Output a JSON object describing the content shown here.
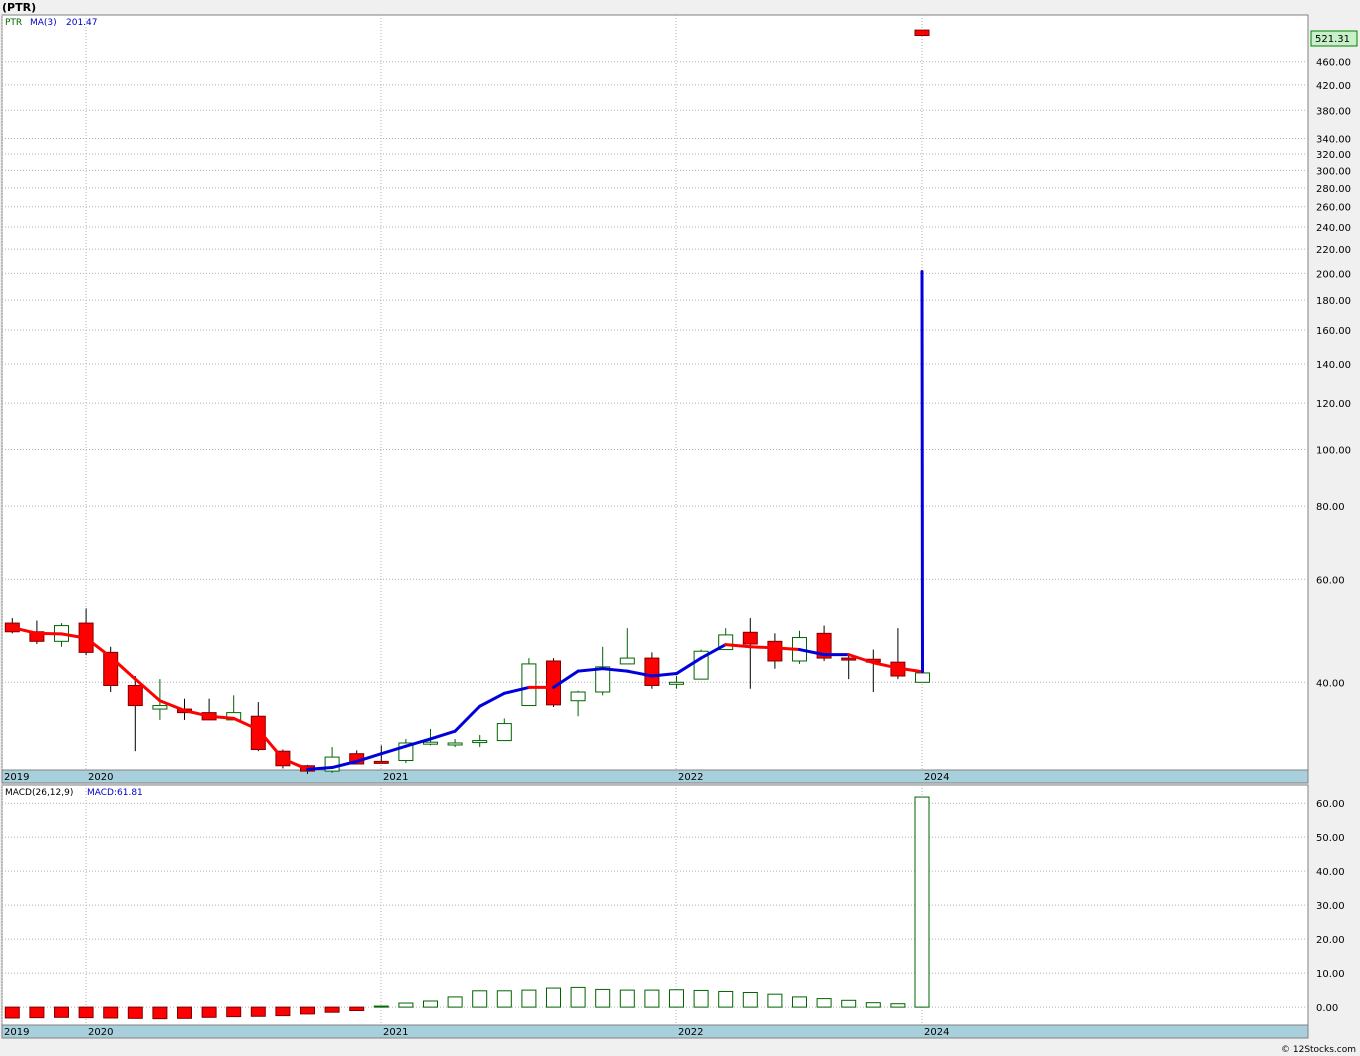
{
  "header": {
    "symbol_label": "(PTR)"
  },
  "legend": {
    "ticker": "PTR",
    "ma_label": "MA(3)",
    "ma_value": "201.47",
    "macd_label": "MACD(26,12,9)",
    "macd_value": "MACD:61.81"
  },
  "last_price_badge": "521.31",
  "footer": {
    "copyright": "© 12Stocks.com"
  },
  "colors": {
    "up_candle": "#006400",
    "down_candle": "#ff0000",
    "ma_up": "#0000dd",
    "ma_down": "#ff0000",
    "axis_band": "#a8d0dc",
    "price_badge": "#c8f0c8",
    "grid": "#b0b0b0"
  },
  "chart_data": [
    {
      "type": "candlestick",
      "title": "(PTR)",
      "scale": "log",
      "series_names": [
        "PTR",
        "MA(3)"
      ],
      "x_tick_labels": [
        "2019",
        "2020",
        "2021",
        "2022",
        "2024"
      ],
      "y_tick_labels": [
        "40.00",
        "60.00",
        "80.00",
        "100.00",
        "120.00",
        "140.00",
        "160.00",
        "180.00",
        "200.00",
        "220.00",
        "240.00",
        "260.00",
        "280.00",
        "300.00",
        "320.00",
        "340.00",
        "380.00",
        "420.00",
        "460.00",
        "521.31"
      ],
      "y_ticks": [
        40,
        60,
        80,
        100,
        120,
        140,
        160,
        180,
        200,
        220,
        240,
        260,
        280,
        300,
        320,
        340,
        380,
        420,
        460
      ],
      "ylim": [
        29,
        540
      ],
      "candles": [
        {
          "d": "2019-11",
          "o": 50.5,
          "h": 51.5,
          "l": 48.5,
          "c": 48.8
        },
        {
          "d": "2019-12",
          "o": 48.8,
          "h": 51.0,
          "l": 46.5,
          "c": 47.0
        },
        {
          "d": "2020-01",
          "o": 47.0,
          "h": 50.5,
          "l": 46.0,
          "c": 50.0
        },
        {
          "d": "2020-02",
          "o": 50.5,
          "h": 53.5,
          "l": 44.5,
          "c": 45.0
        },
        {
          "d": "2020-03",
          "o": 45.0,
          "h": 46.0,
          "l": 38.5,
          "c": 39.5
        },
        {
          "d": "2020-04",
          "o": 39.5,
          "h": 41.0,
          "l": 30.5,
          "c": 36.5
        },
        {
          "d": "2020-05",
          "o": 36.0,
          "h": 40.5,
          "l": 34.5,
          "c": 36.5
        },
        {
          "d": "2020-06",
          "o": 36.0,
          "h": 37.5,
          "l": 34.5,
          "c": 35.5
        },
        {
          "d": "2020-07",
          "o": 35.5,
          "h": 37.5,
          "l": 34.5,
          "c": 34.5
        },
        {
          "d": "2020-08",
          "o": 34.5,
          "h": 38.0,
          "l": 34.5,
          "c": 35.5
        },
        {
          "d": "2020-09",
          "o": 35.0,
          "h": 37.0,
          "l": 30.5,
          "c": 30.7
        },
        {
          "d": "2020-10",
          "o": 30.5,
          "h": 30.7,
          "l": 28.5,
          "c": 28.8
        },
        {
          "d": "2020-11",
          "o": 28.8,
          "h": 28.9,
          "l": 27.9,
          "c": 28.2
        },
        {
          "d": "2020-12",
          "o": 28.2,
          "h": 31.0,
          "l": 28.0,
          "c": 29.8
        },
        {
          "d": "2021-01",
          "o": 30.2,
          "h": 30.6,
          "l": 29.0,
          "c": 29.0
        },
        {
          "d": "2021-02",
          "o": 29.3,
          "h": 31.2,
          "l": 29.1,
          "c": 29.2
        },
        {
          "d": "2021-03",
          "o": 29.4,
          "h": 32.0,
          "l": 29.1,
          "c": 31.5
        },
        {
          "d": "2021-04",
          "o": 31.6,
          "h": 33.3,
          "l": 31.2,
          "c": 31.6
        },
        {
          "d": "2021-05",
          "o": 31.5,
          "h": 32.0,
          "l": 31.0,
          "c": 31.5
        },
        {
          "d": "2021-06",
          "o": 31.7,
          "h": 32.5,
          "l": 31.0,
          "c": 31.8
        },
        {
          "d": "2021-07",
          "o": 31.8,
          "h": 34.7,
          "l": 31.8,
          "c": 34.0
        },
        {
          "d": "2021-08",
          "o": 36.5,
          "h": 44.0,
          "l": 36.5,
          "c": 43.0
        },
        {
          "d": "2021-09",
          "o": 43.5,
          "h": 44.0,
          "l": 36.3,
          "c": 36.6
        },
        {
          "d": "2021-10",
          "o": 37.2,
          "h": 38.7,
          "l": 35.0,
          "c": 38.5
        },
        {
          "d": "2021-11",
          "o": 38.5,
          "h": 46.0,
          "l": 38.0,
          "c": 42.5
        },
        {
          "d": "2021-12",
          "o": 43.0,
          "h": 49.5,
          "l": 43.0,
          "c": 44.0
        },
        {
          "d": "2022-01",
          "o": 44.0,
          "h": 45.0,
          "l": 39.0,
          "c": 39.5
        },
        {
          "d": "2022-02",
          "o": 40.0,
          "h": 41.0,
          "l": 39.0,
          "c": 40.0
        },
        {
          "d": "2022-03",
          "o": 40.5,
          "h": 45.5,
          "l": 40.5,
          "c": 45.2
        },
        {
          "d": "2022-04",
          "o": 45.5,
          "h": 49.5,
          "l": 45.5,
          "c": 48.2
        },
        {
          "d": "2022-05",
          "o": 48.7,
          "h": 51.5,
          "l": 39.0,
          "c": 46.5
        },
        {
          "d": "2022-06",
          "o": 47.0,
          "h": 48.5,
          "l": 42.2,
          "c": 43.5
        },
        {
          "d": "2022-07",
          "o": 43.5,
          "h": 49.0,
          "l": 43.0,
          "c": 47.7
        },
        {
          "d": "2022-08",
          "o": 48.5,
          "h": 50.0,
          "l": 43.5,
          "c": 44.0
        },
        {
          "d": "2022-09",
          "o": 44.0,
          "h": 44.5,
          "l": 40.5,
          "c": 43.8
        },
        {
          "d": "2022-10",
          "o": 43.8,
          "h": 45.5,
          "l": 38.5,
          "c": 43.3
        },
        {
          "d": "2022-11",
          "o": 43.3,
          "h": 49.5,
          "l": 40.5,
          "c": 41.0
        },
        {
          "d": "2022-12",
          "o": 40.0,
          "h": 41.5,
          "l": 40.0,
          "c": 41.5
        },
        {
          "d": "2024-01",
          "o": 521.0,
          "h": 521.31,
          "l": 510.0,
          "c": 510.0
        }
      ],
      "ma3": [
        49.6,
        48.5,
        48.4,
        47.6,
        44.2,
        40.5,
        37.2,
        35.8,
        35.0,
        34.7,
        33.2,
        29.6,
        28.4,
        28.6,
        29.3,
        30.2,
        31.1,
        32.0,
        33.0,
        36.4,
        38.3,
        39.2,
        39.2,
        41.8,
        42.2,
        41.8,
        41.0,
        41.4,
        44.0,
        46.4,
        46.0,
        45.8,
        45.5,
        44.6,
        44.6,
        43.2,
        42.3,
        41.7,
        201.47
      ],
      "ma_colors": [
        "d",
        "d",
        "d",
        "d",
        "d",
        "d",
        "d",
        "d",
        "d",
        "d",
        "d",
        "d",
        "d",
        "u",
        "u",
        "u",
        "u",
        "u",
        "u",
        "u",
        "u",
        "u",
        "d",
        "u",
        "u",
        "u",
        "u",
        "u",
        "u",
        "u",
        "d",
        "d",
        "d",
        "u",
        "u",
        "d",
        "d",
        "d",
        "u"
      ]
    },
    {
      "type": "bar",
      "title": "MACD(26,12,9)",
      "x_tick_labels": [
        "2019",
        "2020",
        "2021",
        "2022",
        "2024"
      ],
      "y_tick_labels": [
        "0.00",
        "10.00",
        "20.00",
        "30.00",
        "40.00",
        "50.00",
        "60.00"
      ],
      "y_ticks": [
        0,
        10,
        20,
        30,
        40,
        50,
        60
      ],
      "ylim": [
        -3.5,
        63
      ],
      "values": [
        -3.2,
        -3.1,
        -3.0,
        -3.1,
        -3.2,
        -3.3,
        -3.4,
        -3.3,
        -3.0,
        -2.8,
        -2.7,
        -2.5,
        -2.0,
        -1.5,
        -1.0,
        0.3,
        1.2,
        1.8,
        3.0,
        4.8,
        4.8,
        5.0,
        5.6,
        5.8,
        5.2,
        5.0,
        5.0,
        5.1,
        4.9,
        4.6,
        4.3,
        3.8,
        3.0,
        2.5,
        2.0,
        1.3,
        1.0,
        61.81
      ]
    }
  ]
}
